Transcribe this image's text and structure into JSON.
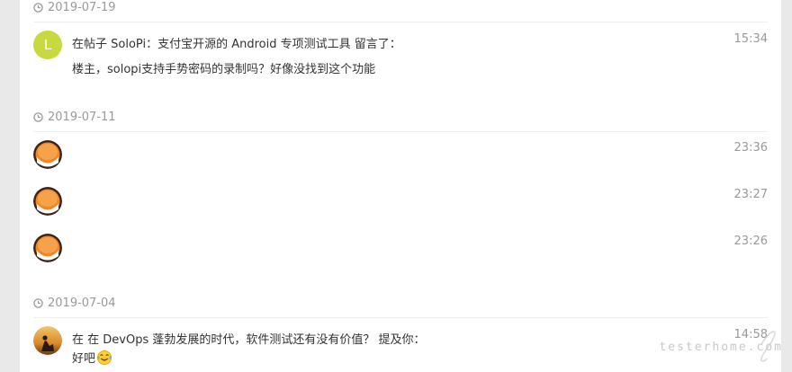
{
  "groups": [
    {
      "date": "2019-07-19",
      "items": [
        {
          "avatar_letter": "L",
          "action": "在帖子 SoloPi：支付宝开源的 Android 专项测试工具 留言了：",
          "content": "楼主，solopi支持手势密码的录制吗？好像没找到这个功能",
          "time": "15:34"
        }
      ]
    },
    {
      "date": "2019-07-11",
      "items": [
        {
          "avatar": "orange-avatar",
          "time": "23:36"
        },
        {
          "avatar": "orange-avatar",
          "time": "23:27"
        },
        {
          "avatar": "orange-avatar",
          "time": "23:26"
        }
      ]
    },
    {
      "date": "2019-07-04",
      "items": [
        {
          "avatar": "photo-avatar",
          "action": "在 在 DevOps 蓬勃发展的时代，软件测试还有没有价值？ 提及你：",
          "content": "好吧",
          "emoji": "tears-of-joy-emoji",
          "time": "14:58"
        }
      ]
    }
  ],
  "watermark": "testerhome.com",
  "colors": {
    "page_bg": "#e9e9e9",
    "panel_bg": "#ffffff",
    "muted_text": "#999999",
    "body_text": "#333333",
    "divider": "#eeeeee",
    "letter_avatar": "#c7d93e",
    "orange_avatar": "#f0882a"
  }
}
